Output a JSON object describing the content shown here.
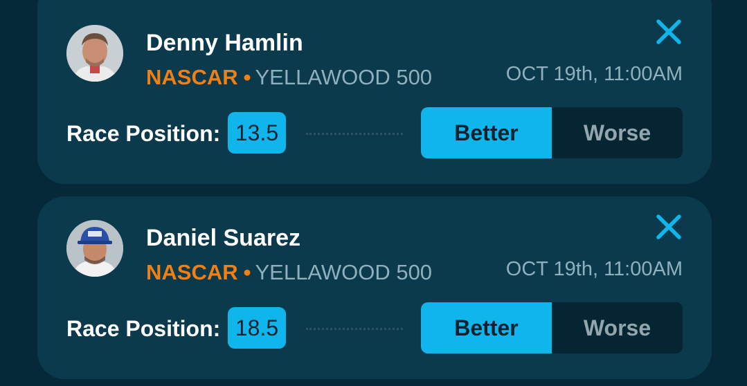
{
  "colors": {
    "background": "#06293a",
    "card": "#0b3a4d",
    "accent": "#10b5ec",
    "league": "#f07f14",
    "muted": "#8fb0bd"
  },
  "picks": [
    {
      "player_name": "Denny Hamlin",
      "league": "NASCAR",
      "separator": "•",
      "event": "YELLAWOOD 500",
      "datetime": "OCT 19th, 11:00AM",
      "stat_label": "Race Position:",
      "line_value": "13.5",
      "better_label": "Better",
      "worse_label": "Worse",
      "selected": "Better",
      "close_icon": "close-icon",
      "avatar": "player-avatar"
    },
    {
      "player_name": "Daniel Suarez",
      "league": "NASCAR",
      "separator": "•",
      "event": "YELLAWOOD 500",
      "datetime": "OCT 19th, 11:00AM",
      "stat_label": "Race Position:",
      "line_value": "18.5",
      "better_label": "Better",
      "worse_label": "Worse",
      "selected": "Better",
      "close_icon": "close-icon",
      "avatar": "player-avatar"
    }
  ]
}
